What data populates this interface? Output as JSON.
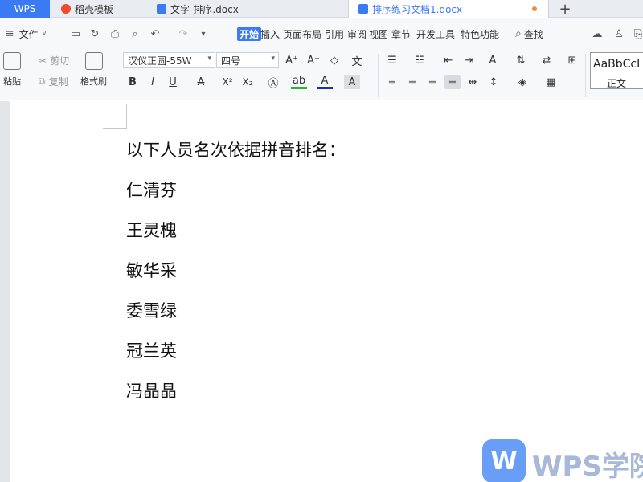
{
  "tabs": {
    "app": "WPS",
    "template": "稻壳模板",
    "doc1": "文字-排序.docx",
    "doc2": "排序练习文档1.docx",
    "add_icon": "+"
  },
  "menubar": {
    "file": "文件",
    "search": "查找",
    "items": [
      "开始",
      "插入",
      "页面布局",
      "引用",
      "审阅",
      "视图",
      "章节",
      "开发工具",
      "特色功能"
    ]
  },
  "ribbon": {
    "paste": "粘贴",
    "cut": "剪切",
    "copy": "复制",
    "format_painter": "格式刷",
    "font_family": "汉仪正圆-55W",
    "font_size": "四号",
    "bold": "B",
    "italic": "I",
    "underline": "U",
    "strike": "A",
    "superscript": "X²",
    "subscript": "X₂",
    "style_sample": "AaBbCcI",
    "style_name": "正文"
  },
  "document": {
    "title_line": "以下人员名次依据拼音排名：",
    "names": [
      "仁清芬",
      "王灵槐",
      "敏华采",
      "委雪绿",
      "冠兰英",
      "冯晶晶"
    ]
  },
  "watermark": {
    "logo": "W",
    "text": "WPS学院"
  },
  "colors": {
    "accent": "#3a7af3"
  }
}
